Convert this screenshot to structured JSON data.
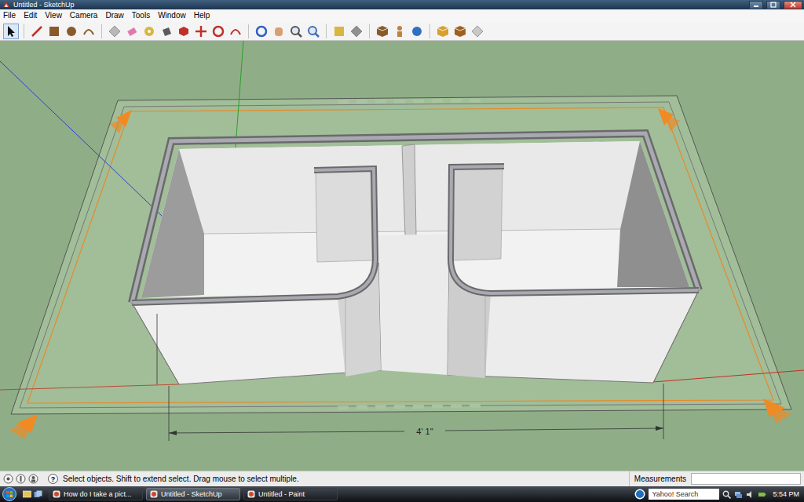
{
  "window": {
    "title": "Untitled - SketchUp"
  },
  "menu": [
    "File",
    "Edit",
    "View",
    "Camera",
    "Draw",
    "Tools",
    "Window",
    "Help"
  ],
  "toolbar_groups": [
    [
      {
        "selected": true
      }
    ],
    [
      {
        "selected": false
      },
      {
        "selected": false
      },
      {
        "selected": false
      },
      {
        "selected": false
      }
    ],
    [
      {
        "selected": false
      },
      {
        "selected": false
      },
      {
        "selected": false
      },
      {
        "selected": false
      },
      {
        "selected": false
      },
      {
        "selected": false
      },
      {
        "selected": false
      },
      {
        "selected": false
      }
    ],
    [
      {
        "selected": false
      },
      {
        "selected": false
      },
      {
        "selected": false
      },
      {
        "selected": false
      }
    ],
    [
      {
        "selected": false
      },
      {
        "selected": false
      }
    ],
    [
      {
        "selected": false
      },
      {
        "selected": false
      },
      {
        "selected": false
      }
    ],
    [
      {
        "selected": false
      },
      {
        "selected": false
      },
      {
        "selected": false
      }
    ]
  ],
  "canvas": {
    "dimension": "4' 1\""
  },
  "status_bar": {
    "help_icon": "?",
    "hint": "Select objects. Shift to extend select. Drag mouse to select multiple.",
    "measurements": {
      "label": "Measurements",
      "value": ""
    }
  },
  "taskbar": {
    "tasks": [
      {
        "label": "How do I take a pict...",
        "selected": false
      },
      {
        "label": "Untitled - SketchUp",
        "selected": true
      },
      {
        "label": "Untitled - Paint",
        "selected": false
      }
    ],
    "search": {
      "placeholder": "Yahoo! Search"
    },
    "clock": "5:54 PM"
  }
}
